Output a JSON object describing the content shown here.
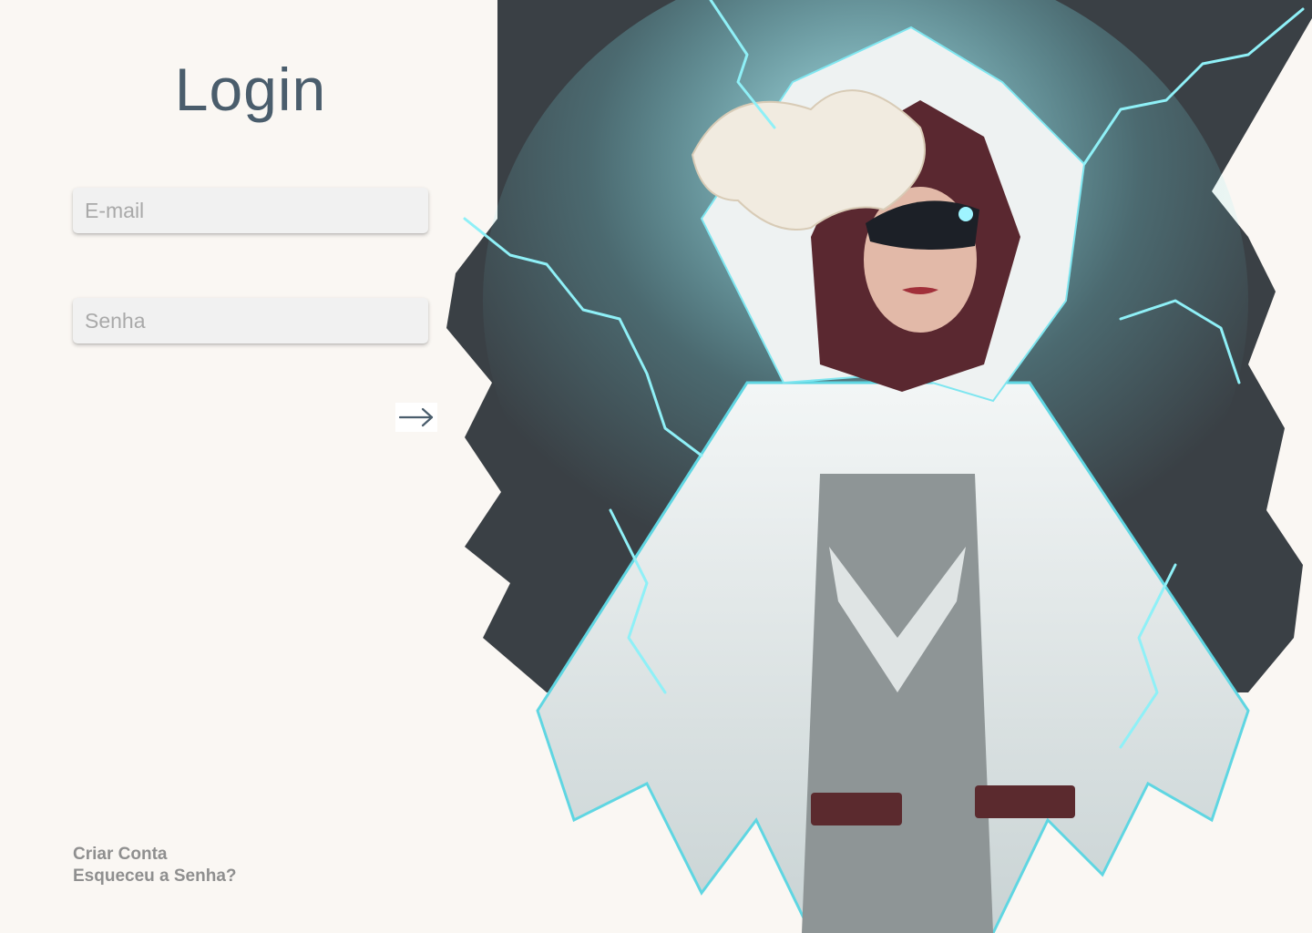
{
  "login": {
    "title": "Login",
    "email_placeholder": "E-mail",
    "password_placeholder": "Senha",
    "submit_icon": "arrow-right-icon"
  },
  "links": {
    "create_account": "Criar Conta",
    "forgot_password": "Esqueceu a Senha?"
  },
  "illustration": {
    "subject": "hooded-lightning-heroine"
  },
  "colors": {
    "background": "#faf7f3",
    "title": "#4a5d6c",
    "link": "#8f8f8f",
    "input_bg": "#f1f1f1",
    "art_dark": "#3a4045",
    "lightning": "#7fe6f0"
  }
}
